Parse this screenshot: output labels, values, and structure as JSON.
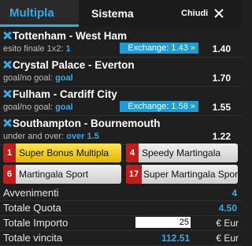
{
  "tabs": {
    "multipla": "Multipla",
    "sistema": "Sistema"
  },
  "close_label": "Chiudi",
  "bets": [
    {
      "match": "Tottenham - West Ham",
      "market_prefix": "esito finale 1x2: ",
      "selection": "1",
      "exchange_label": "Exchange: ",
      "exchange_value": "1.43 »",
      "odds": "1.40"
    },
    {
      "match": "Crystal Palace - Everton",
      "market_prefix": "goal/no goal: ",
      "selection": "goal",
      "exchange_label": "",
      "exchange_value": "",
      "odds": "1.70"
    },
    {
      "match": "Fulham - Cardiff City",
      "market_prefix": "goal/no goal: ",
      "selection": "goal",
      "exchange_label": "Exchange: ",
      "exchange_value": "1.58 »",
      "odds": "1.55"
    },
    {
      "match": "Southampton - Bournemouth",
      "market_prefix": "under and over: ",
      "selection": "over 1.5",
      "exchange_label": "",
      "exchange_value": "",
      "odds": "1.22"
    }
  ],
  "bonuses": {
    "b1": {
      "num": "1",
      "label": "Super Bonus Multipla"
    },
    "b4": {
      "num": "4",
      "label": "Speedy Martingala"
    },
    "b6": {
      "num": "6",
      "label": "Martingala Sport"
    },
    "b17": {
      "num": "17",
      "label": "Super Martingala Sport"
    }
  },
  "totals": {
    "avvenimenti_label": "Avvenimenti",
    "avvenimenti_value": "4",
    "quota_label": "Totale Quota",
    "quota_value": "4.50",
    "importo_label": "Totale Importo",
    "importo_value": "25",
    "importo_currency": "€ Eur",
    "vincita_label": "Totale vincita",
    "vincita_value": "112.51",
    "vincita_currency": "€ Eur"
  },
  "colors": {
    "accent": "#35a8e6",
    "exchange_bg": "#1e9ad6",
    "bonus_red": "#c21d1d",
    "bonus_yellow": "#ffe45a"
  }
}
